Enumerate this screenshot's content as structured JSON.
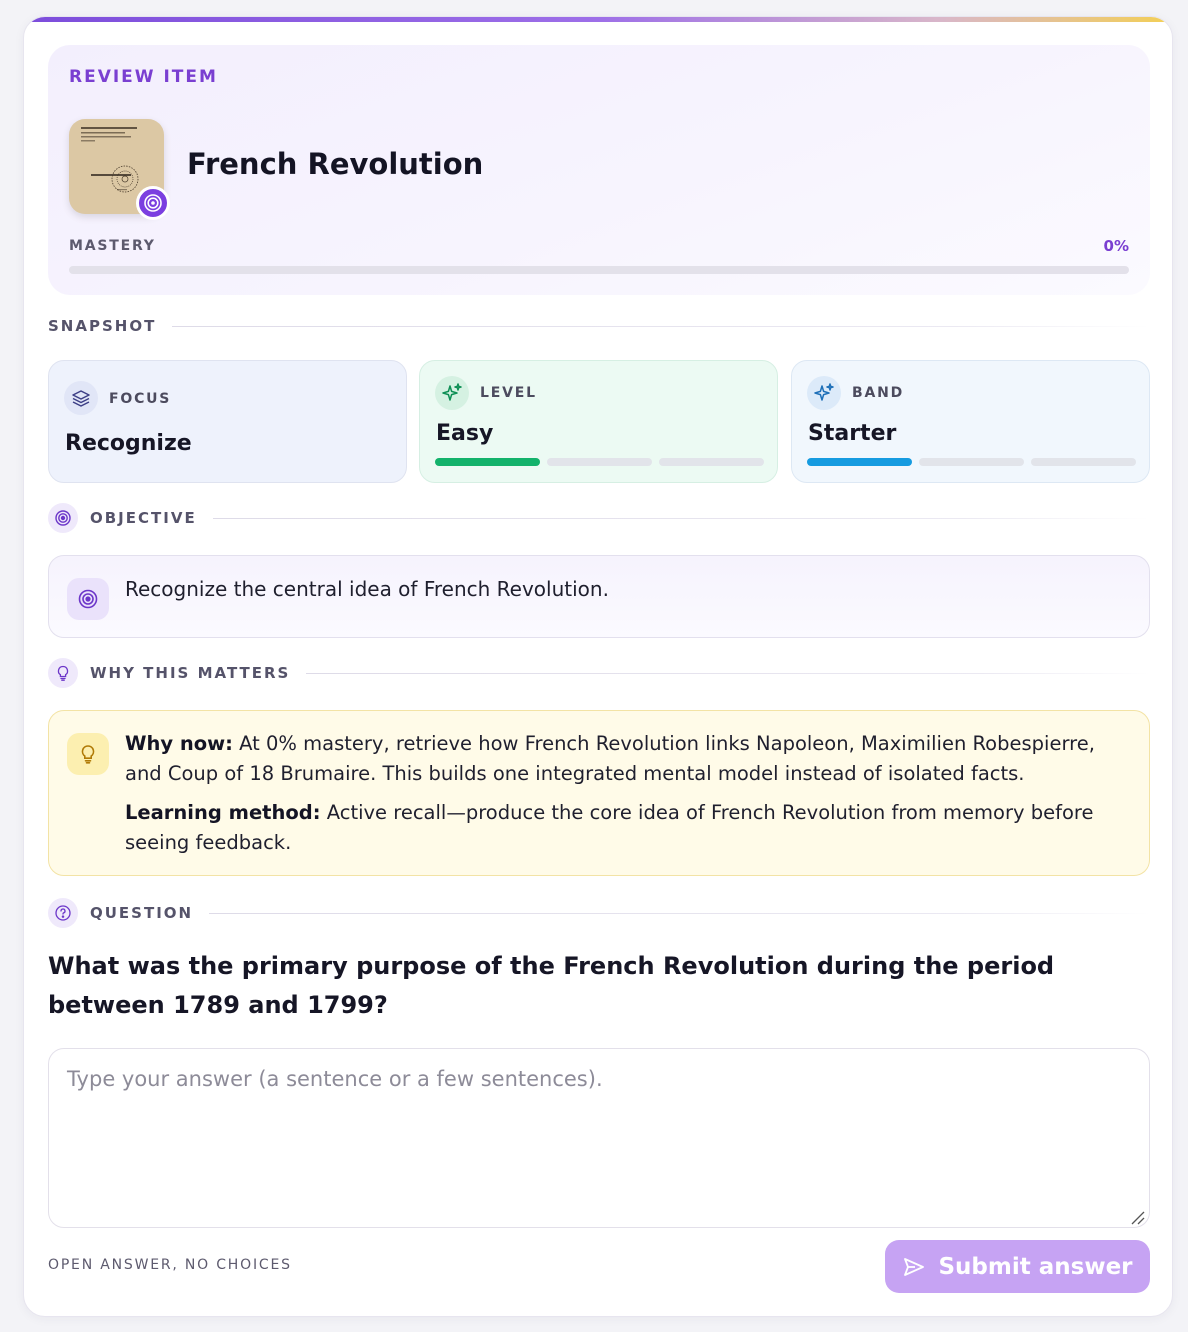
{
  "header": {
    "eyebrow": "REVIEW ITEM",
    "title": "French Revolution",
    "mastery_label": "MASTERY",
    "mastery_value": "0%",
    "mastery_fraction": 0,
    "thumbnail_icon": "manuscript-thumbnail",
    "badge_icon": "target-icon"
  },
  "snapshot": {
    "label": "SNAPSHOT",
    "focus": {
      "label": "FOCUS",
      "value": "Recognize",
      "icon": "layers-icon"
    },
    "level": {
      "label": "LEVEL",
      "value": "Easy",
      "icon": "sparkle-icon",
      "filled_segments": 1,
      "total_segments": 3,
      "color": "#13b26b"
    },
    "band": {
      "label": "BAND",
      "value": "Starter",
      "icon": "sparkle-icon",
      "filled_segments": 1,
      "total_segments": 3,
      "color": "#169be0"
    }
  },
  "objective": {
    "label": "OBJECTIVE",
    "text": "Recognize the central idea of French Revolution."
  },
  "why": {
    "label": "WHY THIS MATTERS",
    "now_label": "Why now:",
    "now_text": " At 0% mastery, retrieve how French Revolution links Napoleon, Maximilien Robespierre, and Coup of 18 Brumaire. This builds one integrated mental model instead of isolated facts.",
    "method_label": "Learning method:",
    "method_text": " Active recall—produce the core idea of French Revolution from memory before seeing feedback."
  },
  "question": {
    "label": "QUESTION",
    "text": "What was the primary purpose of the French Revolution during the period between 1789 and 1799?",
    "answer_value": "",
    "answer_placeholder": "Type your answer (a sentence or a few sentences)."
  },
  "footer": {
    "note": "OPEN ANSWER, NO CHOICES",
    "submit_label": "Submit answer"
  },
  "colors": {
    "accent": "#7a3fd1",
    "submit_disabled": "#c6a3f3",
    "why_bg": "#fffbe8"
  }
}
